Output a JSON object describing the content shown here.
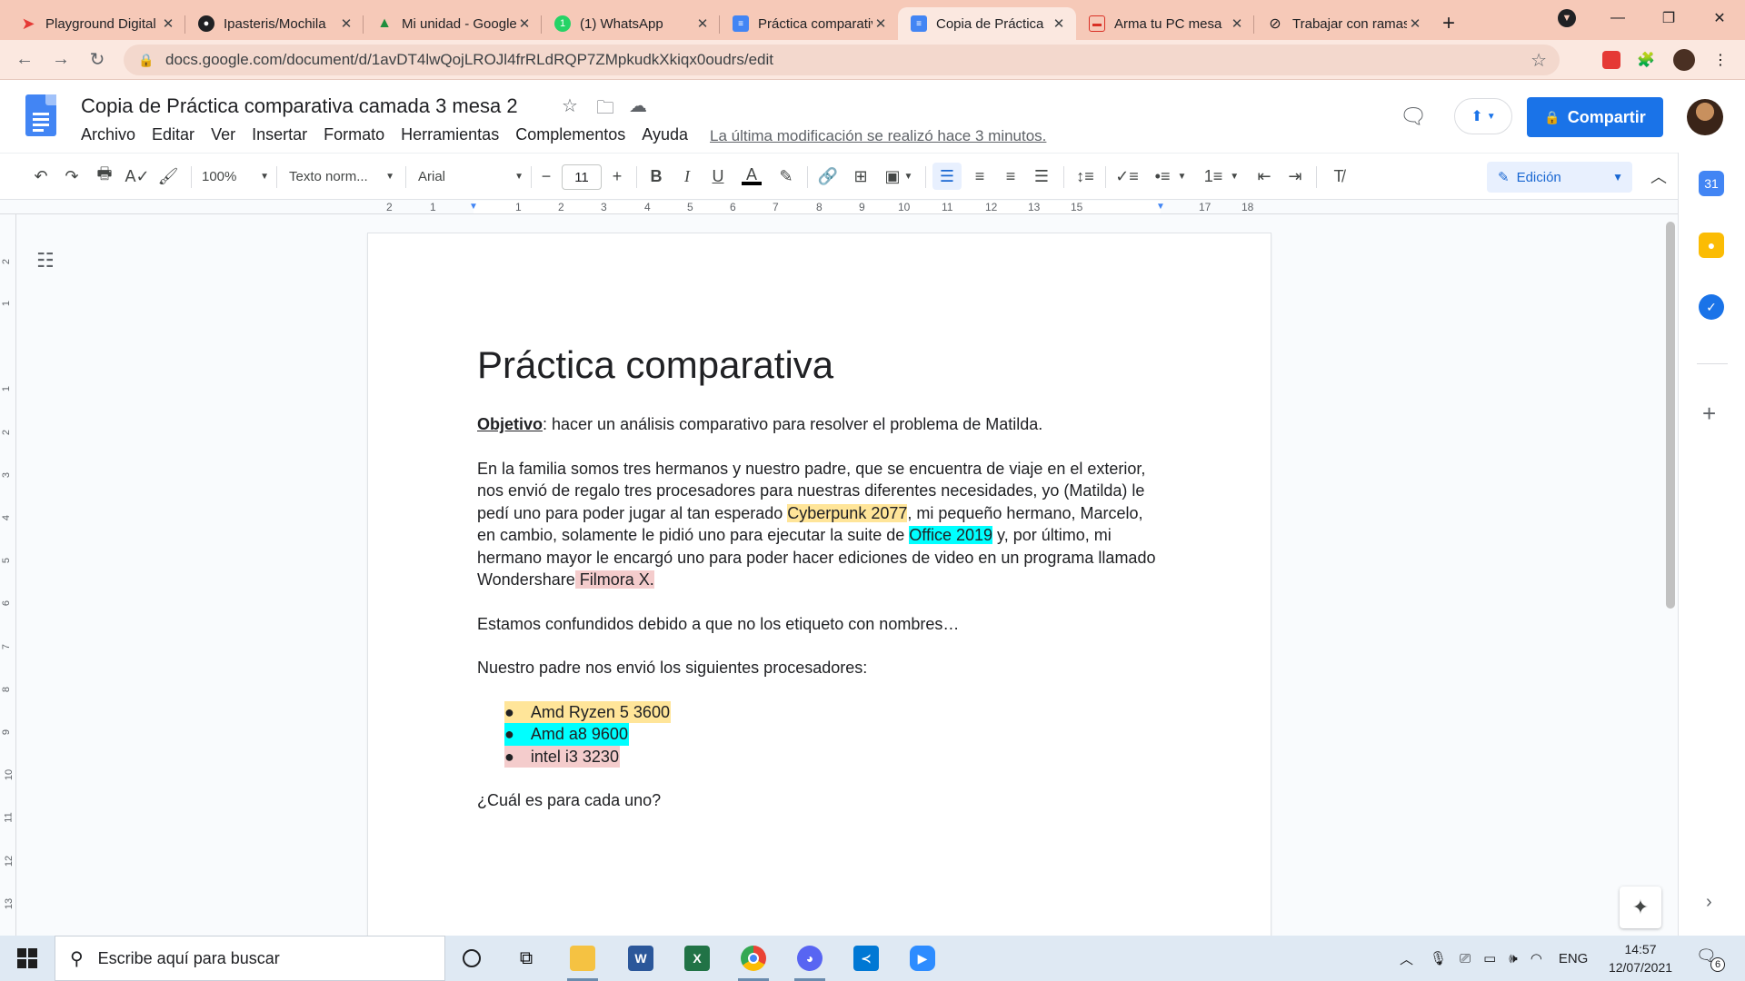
{
  "browser": {
    "tabs": [
      {
        "title": "Playground Digital",
        "icon": "playground-icon",
        "color": "#e53935",
        "active": false
      },
      {
        "title": "Ipasteris/Mochila",
        "icon": "github-icon",
        "color": "#202124",
        "active": false
      },
      {
        "title": "Mi unidad - Google Drive",
        "icon": "drive-icon",
        "color": "#1e8e3e",
        "active": false
      },
      {
        "title": "(1) WhatsApp",
        "icon": "whatsapp-icon",
        "color": "#25d366",
        "active": false
      },
      {
        "title": "Práctica comparativa",
        "icon": "docs-icon",
        "color": "#4285f4",
        "active": false
      },
      {
        "title": "Copia de Práctica",
        "icon": "docs-icon",
        "color": "#4285f4",
        "active": true
      },
      {
        "title": "Arma tu PC mesa",
        "icon": "site-icon",
        "color": "#d93025",
        "active": false
      },
      {
        "title": "Trabajar con ramas",
        "icon": "link-icon",
        "color": "#202124",
        "active": false
      }
    ],
    "url": "docs.google.com/document/d/1avDT4lwQojLROJl4frRLdRQP7ZMpkudkXkiqx0oudrs/edit"
  },
  "docs": {
    "title": "Copia de  Práctica comparativa camada 3 mesa 2",
    "menu": [
      "Archivo",
      "Editar",
      "Ver",
      "Insertar",
      "Formato",
      "Herramientas",
      "Complementos",
      "Ayuda"
    ],
    "last_edit": "La última modificación se realizó hace 3 minutos.",
    "share_label": "Compartir",
    "toolbar": {
      "zoom": "100%",
      "style": "Texto norm...",
      "font": "Arial",
      "font_size": "11",
      "mode": "Edición"
    },
    "ruler_numbers": [
      "2",
      "1",
      "1",
      "2",
      "3",
      "4",
      "5",
      "6",
      "7",
      "8",
      "9",
      "10",
      "11",
      "12",
      "13",
      "15",
      "17",
      "18"
    ],
    "vruler_numbers": [
      "2",
      "1",
      "1",
      "2",
      "3",
      "4",
      "5",
      "6",
      "7",
      "8",
      "9",
      "10",
      "11",
      "12",
      "13"
    ]
  },
  "document": {
    "heading": "Práctica comparativa",
    "objective_label": "Objetivo",
    "objective_text": ": hacer un análisis comparativo para resolver el problema de Matilda.",
    "para1_a": "En la familia somos tres hermanos y nuestro padre, que se encuentra de viaje en el exterior, nos envió de regalo tres procesadores para nuestras diferentes necesidades, yo (Matilda) le pedí uno para poder jugar al tan esperado ",
    "para1_game": "Cyberpunk 2077",
    "para1_b": ", mi pequeño hermano, Marcelo, en cambio, solamente le pidió uno para ejecutar la suite de ",
    "para1_office": "Office 2019",
    "para1_c": " y, por último, mi hermano mayor le encargó uno para poder hacer ediciones de video en un programa llamado Wondershare",
    "para1_filmora": " Filmora X.",
    "para2": "Estamos confundidos debido a que no los etiqueto con nombres…",
    "para3": "Nuestro padre nos envió los siguientes procesadores:",
    "processors": [
      "Amd Ryzen 5 3600",
      "Amd a8 9600",
      "intel i3 3230"
    ],
    "question": "¿Cuál es para cada uno?"
  },
  "taskbar": {
    "search_placeholder": "Escribe aquí para buscar",
    "language": "ENG",
    "time": "14:57",
    "date": "12/07/2021",
    "notifications": "6"
  },
  "colors": {
    "highlight_yellow": "#ffe599",
    "highlight_cyan": "#00ffff",
    "highlight_pink": "#f4cccc",
    "accent": "#1a73e8"
  }
}
